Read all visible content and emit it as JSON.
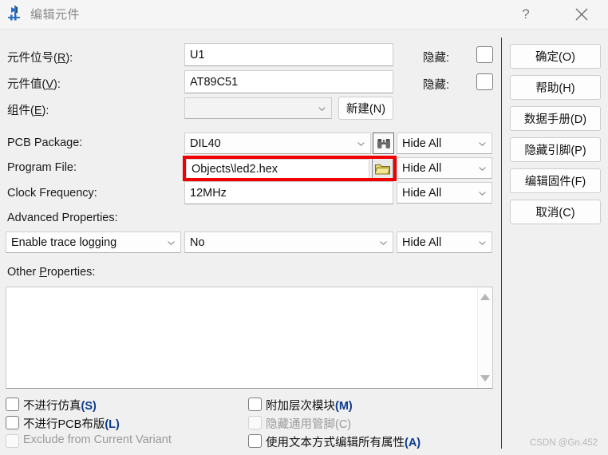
{
  "window": {
    "title": "编辑元件",
    "icon": "component-diode-icon",
    "help_label": "?",
    "close_label": "×"
  },
  "form": {
    "rows": [
      {
        "label_html": "元件位号(<u>R</u>):",
        "value": "U1",
        "hide_label": "隐藏:",
        "hide_checked": false
      },
      {
        "label_html": "元件值(<u>V</u>):",
        "value": "AT89C51",
        "hide_label": "隐藏:",
        "hide_checked": false
      },
      {
        "label_html": "组件(<u>E</u>):",
        "value": "",
        "new_button": "新建(N)"
      }
    ],
    "pcb_package": {
      "label": "PCB Package:",
      "value": "DIL40",
      "browse_icon": "binoculars-icon",
      "hide_mode": "Hide All"
    },
    "program_file": {
      "label": "Program File:",
      "value": "Objects\\led2.hex",
      "browse_icon": "folder-open-icon",
      "hide_mode": "Hide All"
    },
    "clock_frequency": {
      "label": "Clock Frequency:",
      "value": "12MHz",
      "hide_mode": "Hide All"
    },
    "advanced_properties": {
      "label": "Advanced Properties:",
      "property": "Enable trace logging",
      "value": "No",
      "hide_mode": "Hide All"
    },
    "other_properties": {
      "label_html": "Other <u>P</u>roperties:",
      "value": ""
    }
  },
  "buttons": [
    {
      "label": "确定(O)",
      "name": "ok-button"
    },
    {
      "label": "帮助(H)",
      "name": "help-button"
    },
    {
      "label": "数据手册(D)",
      "name": "datasheet-button"
    },
    {
      "label": "隐藏引脚(P)",
      "name": "hide-pins-button"
    },
    {
      "label": "编辑固件(F)",
      "name": "edit-firmware-button"
    },
    {
      "label": "取消(C)",
      "name": "cancel-button"
    }
  ],
  "checkboxes_left": [
    {
      "text": "不进行仿真",
      "accel": "(S)",
      "checked": false,
      "disabled": false
    },
    {
      "text": "不进行PCB布版",
      "accel": "(L)",
      "checked": false,
      "disabled": false
    },
    {
      "text": "Exclude from Current Variant",
      "accel": "",
      "checked": false,
      "disabled": true
    }
  ],
  "checkboxes_right": [
    {
      "text": "附加层次模块",
      "accel": "(M)",
      "checked": false,
      "disabled": false
    },
    {
      "text": "隐藏通用管脚",
      "accel": "(C)",
      "checked": false,
      "disabled": true
    },
    {
      "text": "使用文本方式编辑所有属性",
      "accel": "(A)",
      "checked": false,
      "disabled": false
    }
  ],
  "watermark": "CSDN @Gn.452",
  "colors": {
    "window_bg": "#f0f0f0",
    "titlebar_bg": "#f5f5f5",
    "accent_red": "#f00000",
    "accel_blue": "#0d3b8c",
    "icon_blue": "#1f6fd0"
  }
}
